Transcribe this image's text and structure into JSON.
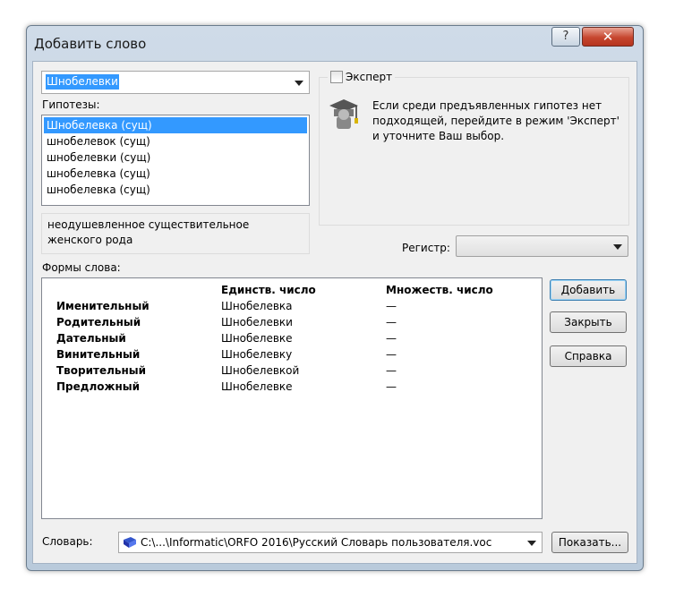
{
  "window": {
    "title": "Добавить слово"
  },
  "word_input": {
    "value": "Шнобелевки"
  },
  "hypotheses": {
    "label": "Гипотезы:",
    "items": [
      "Шнобелевка  (сущ)",
      "шнобелевок  (сущ)",
      "шнобелевки  (сущ)",
      "шнобелевка  (сущ)",
      "шнобелевка  (сущ)"
    ],
    "selected_index": 0
  },
  "description": "неодушевленное существительное женского рода",
  "expert": {
    "label": "Эксперт",
    "checked": false,
    "hint": "Если среди предъявленных гипотез нет подходящей, перейдите в режим 'Эксперт' и уточните Ваш выбор."
  },
  "register": {
    "label": "Регистр:",
    "value": ""
  },
  "forms": {
    "label": "Формы слова:",
    "col_singular": "Единств. число",
    "col_plural": "Множеств. число",
    "rows": [
      {
        "case": "Именительный",
        "singular": "Шнобелевка",
        "plural": "—"
      },
      {
        "case": "Родительный",
        "singular": "Шнобелевки",
        "plural": "—"
      },
      {
        "case": "Дательный",
        "singular": "Шнобелевке",
        "plural": "—"
      },
      {
        "case": "Винительный",
        "singular": "Шнобелевку",
        "plural": "—"
      },
      {
        "case": "Творительный",
        "singular": "Шнобелевкой",
        "plural": "—"
      },
      {
        "case": "Предложный",
        "singular": "Шнобелевке",
        "plural": "—"
      }
    ]
  },
  "buttons": {
    "add": "Добавить",
    "close": "Закрыть",
    "help": "Справка",
    "show": "Показать..."
  },
  "dictionary": {
    "label": "Словарь:",
    "path": "C:\\...\\Informatic\\ORFO 2016\\Русский Словарь пользователя.voc"
  },
  "titlebar_buttons": {
    "help_glyph": "?",
    "close_glyph": "✕"
  }
}
